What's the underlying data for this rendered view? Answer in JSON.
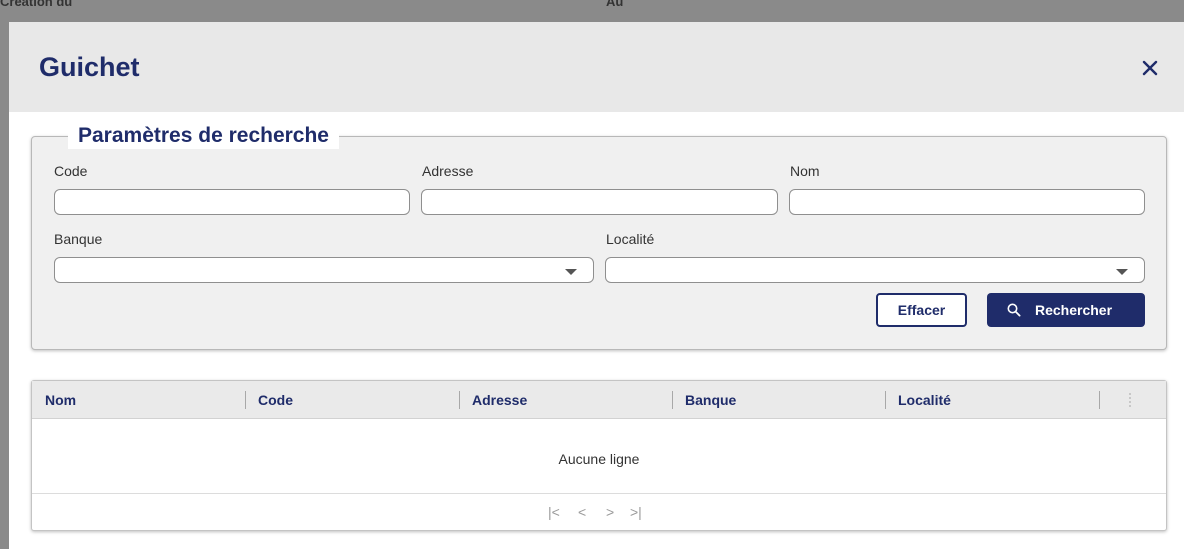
{
  "background": {
    "top_left_text": "Création du",
    "top_mid_text": "Au"
  },
  "dialog": {
    "title": "Guichet",
    "close_icon": "close-icon"
  },
  "search": {
    "legend": "Paramètres de recherche",
    "code_label": "Code",
    "code_value": "",
    "adresse_label": "Adresse",
    "adresse_value": "",
    "nom_label": "Nom",
    "nom_value": "",
    "banque_label": "Banque",
    "banque_value": "",
    "localite_label": "Localité",
    "localite_value": "",
    "clear_button": "Effacer",
    "search_button": "Rechercher",
    "search_icon": "search-icon"
  },
  "grid": {
    "columns": [
      "Nom",
      "Code",
      "Adresse",
      "Banque",
      "Localité"
    ],
    "empty_message": "Aucune ligne",
    "pager": {
      "first": "|<",
      "prev": "<",
      "next": ">",
      "last": ">|"
    }
  },
  "colors": {
    "accent": "#1f2c6a",
    "header_bg": "#e8e8e8",
    "panel_bg": "#f0f0f0"
  }
}
